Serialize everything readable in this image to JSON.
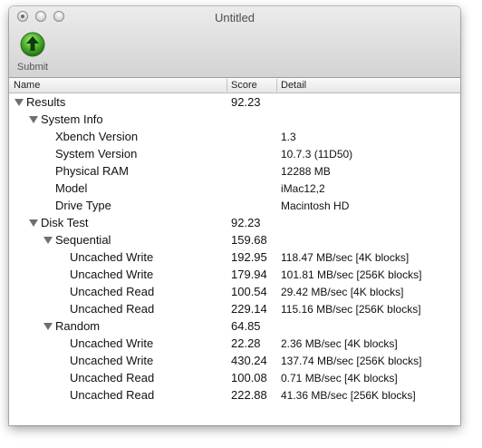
{
  "window": {
    "title": "Untitled"
  },
  "toolbar": {
    "submit_label": "Submit",
    "submit_icon": "green-upload-arrow"
  },
  "columns": {
    "name": "Name",
    "score": "Score",
    "detail": "Detail"
  },
  "rows": [
    {
      "name": "Results",
      "score": "92.23",
      "detail": "",
      "depth": 0,
      "expandable": true
    },
    {
      "name": "System Info",
      "score": "",
      "detail": "",
      "depth": 1,
      "expandable": true
    },
    {
      "name": "Xbench Version",
      "score": "",
      "detail": "1.3",
      "depth": 2,
      "expandable": false
    },
    {
      "name": "System Version",
      "score": "",
      "detail": "10.7.3 (11D50)",
      "depth": 2,
      "expandable": false
    },
    {
      "name": "Physical RAM",
      "score": "",
      "detail": "12288 MB",
      "depth": 2,
      "expandable": false
    },
    {
      "name": "Model",
      "score": "",
      "detail": "iMac12,2",
      "depth": 2,
      "expandable": false
    },
    {
      "name": "Drive Type",
      "score": "",
      "detail": "Macintosh HD",
      "depth": 2,
      "expandable": false
    },
    {
      "name": "Disk Test",
      "score": "92.23",
      "detail": "",
      "depth": 1,
      "expandable": true
    },
    {
      "name": "Sequential",
      "score": "159.68",
      "detail": "",
      "depth": 2,
      "expandable": true
    },
    {
      "name": "Uncached Write",
      "score": "192.95",
      "detail": "118.47 MB/sec [4K blocks]",
      "depth": 3,
      "expandable": false
    },
    {
      "name": "Uncached Write",
      "score": "179.94",
      "detail": "101.81 MB/sec [256K blocks]",
      "depth": 3,
      "expandable": false
    },
    {
      "name": "Uncached Read",
      "score": "100.54",
      "detail": "29.42 MB/sec [4K blocks]",
      "depth": 3,
      "expandable": false
    },
    {
      "name": "Uncached Read",
      "score": "229.14",
      "detail": "115.16 MB/sec [256K blocks]",
      "depth": 3,
      "expandable": false
    },
    {
      "name": "Random",
      "score": "64.85",
      "detail": "",
      "depth": 2,
      "expandable": true
    },
    {
      "name": "Uncached Write",
      "score": "22.28",
      "detail": "2.36 MB/sec [4K blocks]",
      "depth": 3,
      "expandable": false
    },
    {
      "name": "Uncached Write",
      "score": "430.24",
      "detail": "137.74 MB/sec [256K blocks]",
      "depth": 3,
      "expandable": false
    },
    {
      "name": "Uncached Read",
      "score": "100.08",
      "detail": "0.71 MB/sec [4K blocks]",
      "depth": 3,
      "expandable": false
    },
    {
      "name": "Uncached Read",
      "score": "222.88",
      "detail": "41.36 MB/sec [256K blocks]",
      "depth": 3,
      "expandable": false
    }
  ]
}
